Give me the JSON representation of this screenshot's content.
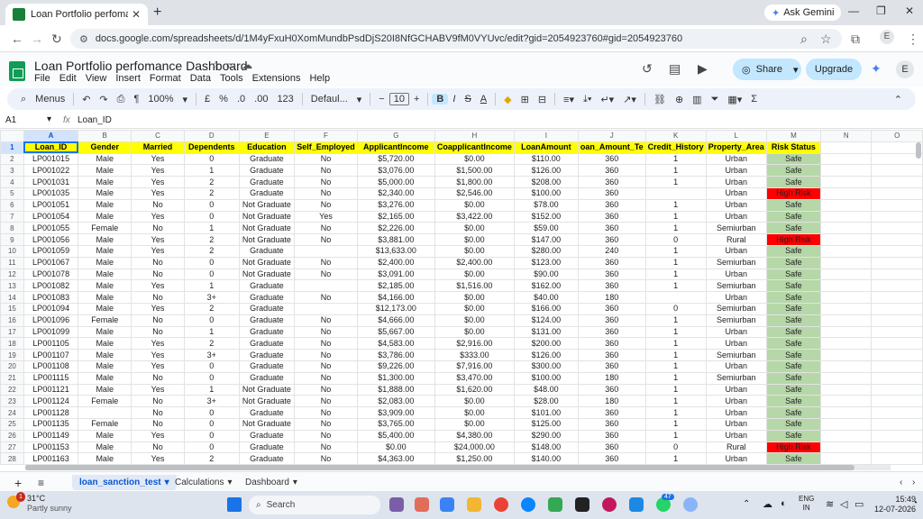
{
  "browser": {
    "tab_title": "Loan Portfolio perfomance Dash",
    "ask_gemini": "Ask Gemini",
    "url": "docs.google.com/spreadsheets/d/1M4yFxuH0XomMundbPsdDjS20I8NfGCHABV9fM0VYUvc/edit?gid=2054923760#gid=2054923760",
    "profile_initial": "E"
  },
  "sheets": {
    "title": "Loan Portfolio perfomance Dashboard",
    "menu": [
      "File",
      "Edit",
      "View",
      "Insert",
      "Format",
      "Data",
      "Tools",
      "Extensions",
      "Help"
    ],
    "share_label": "Share",
    "upgrade_label": "Upgrade",
    "profile_initial": "E"
  },
  "toolbar": {
    "menus": "Menus",
    "zoom": "100%",
    "currency": "£",
    "percent": "%",
    "dec_decrease": ".0",
    "dec_increase": ".00",
    "number_format": "123",
    "font": "Defaul...",
    "font_size": "10",
    "bold": "B",
    "italic": "I",
    "strike": "S",
    "text_color": "A",
    "sum": "Σ"
  },
  "formula_bar": {
    "name_box": "A1",
    "fx": "fx",
    "formula": "Loan_ID"
  },
  "columns": [
    "A",
    "B",
    "C",
    "D",
    "E",
    "F",
    "G",
    "H",
    "I",
    "J",
    "K",
    "L",
    "M",
    "N",
    "O"
  ],
  "headers": [
    "Loan_ID",
    "Gender",
    "Married",
    "Dependents",
    "Education",
    "Self_Employed",
    "ApplicantIncome",
    "CoapplicantIncome",
    "LoanAmount",
    "oan_Amount_Te",
    "Credit_History",
    "Property_Area",
    "Risk Status",
    "",
    ""
  ],
  "rows": [
    [
      "LP001015",
      "Male",
      "Yes",
      "0",
      "Graduate",
      "No",
      "$5,720.00",
      "$0.00",
      "$110.00",
      "360",
      "1",
      "Urban",
      "Safe"
    ],
    [
      "LP001022",
      "Male",
      "Yes",
      "1",
      "Graduate",
      "No",
      "$3,076.00",
      "$1,500.00",
      "$126.00",
      "360",
      "1",
      "Urban",
      "Safe"
    ],
    [
      "LP001031",
      "Male",
      "Yes",
      "2",
      "Graduate",
      "No",
      "$5,000.00",
      "$1,800.00",
      "$208.00",
      "360",
      "1",
      "Urban",
      "Safe"
    ],
    [
      "LP001035",
      "Male",
      "Yes",
      "2",
      "Graduate",
      "No",
      "$2,340.00",
      "$2,546.00",
      "$100.00",
      "360",
      "",
      "Urban",
      "High Risk"
    ],
    [
      "LP001051",
      "Male",
      "No",
      "0",
      "Not Graduate",
      "No",
      "$3,276.00",
      "$0.00",
      "$78.00",
      "360",
      "1",
      "Urban",
      "Safe"
    ],
    [
      "LP001054",
      "Male",
      "Yes",
      "0",
      "Not Graduate",
      "Yes",
      "$2,165.00",
      "$3,422.00",
      "$152.00",
      "360",
      "1",
      "Urban",
      "Safe"
    ],
    [
      "LP001055",
      "Female",
      "No",
      "1",
      "Not Graduate",
      "No",
      "$2,226.00",
      "$0.00",
      "$59.00",
      "360",
      "1",
      "Semiurban",
      "Safe"
    ],
    [
      "LP001056",
      "Male",
      "Yes",
      "2",
      "Not Graduate",
      "No",
      "$3,881.00",
      "$0.00",
      "$147.00",
      "360",
      "0",
      "Rural",
      "High Risk"
    ],
    [
      "LP001059",
      "Male",
      "Yes",
      "2",
      "Graduate",
      "",
      "$13,633.00",
      "$0.00",
      "$280.00",
      "240",
      "1",
      "Urban",
      "Safe"
    ],
    [
      "LP001067",
      "Male",
      "No",
      "0",
      "Not Graduate",
      "No",
      "$2,400.00",
      "$2,400.00",
      "$123.00",
      "360",
      "1",
      "Semiurban",
      "Safe"
    ],
    [
      "LP001078",
      "Male",
      "No",
      "0",
      "Not Graduate",
      "No",
      "$3,091.00",
      "$0.00",
      "$90.00",
      "360",
      "1",
      "Urban",
      "Safe"
    ],
    [
      "LP001082",
      "Male",
      "Yes",
      "1",
      "Graduate",
      "",
      "$2,185.00",
      "$1,516.00",
      "$162.00",
      "360",
      "1",
      "Semiurban",
      "Safe"
    ],
    [
      "LP001083",
      "Male",
      "No",
      "3+",
      "Graduate",
      "No",
      "$4,166.00",
      "$0.00",
      "$40.00",
      "180",
      "",
      "Urban",
      "Safe"
    ],
    [
      "LP001094",
      "Male",
      "Yes",
      "2",
      "Graduate",
      "",
      "$12,173.00",
      "$0.00",
      "$166.00",
      "360",
      "0",
      "Semiurban",
      "Safe"
    ],
    [
      "LP001096",
      "Female",
      "No",
      "0",
      "Graduate",
      "No",
      "$4,666.00",
      "$0.00",
      "$124.00",
      "360",
      "1",
      "Semiurban",
      "Safe"
    ],
    [
      "LP001099",
      "Male",
      "No",
      "1",
      "Graduate",
      "No",
      "$5,667.00",
      "$0.00",
      "$131.00",
      "360",
      "1",
      "Urban",
      "Safe"
    ],
    [
      "LP001105",
      "Male",
      "Yes",
      "2",
      "Graduate",
      "No",
      "$4,583.00",
      "$2,916.00",
      "$200.00",
      "360",
      "1",
      "Urban",
      "Safe"
    ],
    [
      "LP001107",
      "Male",
      "Yes",
      "3+",
      "Graduate",
      "No",
      "$3,786.00",
      "$333.00",
      "$126.00",
      "360",
      "1",
      "Semiurban",
      "Safe"
    ],
    [
      "LP001108",
      "Male",
      "Yes",
      "0",
      "Graduate",
      "No",
      "$9,226.00",
      "$7,916.00",
      "$300.00",
      "360",
      "1",
      "Urban",
      "Safe"
    ],
    [
      "LP001115",
      "Male",
      "No",
      "0",
      "Graduate",
      "No",
      "$1,300.00",
      "$3,470.00",
      "$100.00",
      "180",
      "1",
      "Semiurban",
      "Safe"
    ],
    [
      "LP001121",
      "Male",
      "Yes",
      "1",
      "Not Graduate",
      "No",
      "$1,888.00",
      "$1,620.00",
      "$48.00",
      "360",
      "1",
      "Urban",
      "Safe"
    ],
    [
      "LP001124",
      "Female",
      "No",
      "3+",
      "Not Graduate",
      "No",
      "$2,083.00",
      "$0.00",
      "$28.00",
      "180",
      "1",
      "Urban",
      "Safe"
    ],
    [
      "LP001128",
      "",
      "No",
      "0",
      "Graduate",
      "No",
      "$3,909.00",
      "$0.00",
      "$101.00",
      "360",
      "1",
      "Urban",
      "Safe"
    ],
    [
      "LP001135",
      "Female",
      "No",
      "0",
      "Not Graduate",
      "No",
      "$3,765.00",
      "$0.00",
      "$125.00",
      "360",
      "1",
      "Urban",
      "Safe"
    ],
    [
      "LP001149",
      "Male",
      "Yes",
      "0",
      "Graduate",
      "No",
      "$5,400.00",
      "$4,380.00",
      "$290.00",
      "360",
      "1",
      "Urban",
      "Safe"
    ],
    [
      "LP001153",
      "Male",
      "No",
      "0",
      "Graduate",
      "No",
      "$0.00",
      "$24,000.00",
      "$148.00",
      "360",
      "0",
      "Rural",
      "High Risk"
    ],
    [
      "LP001163",
      "Male",
      "Yes",
      "2",
      "Graduate",
      "No",
      "$4,363.00",
      "$1,250.00",
      "$140.00",
      "360",
      "1",
      "Urban",
      "Safe"
    ]
  ],
  "sheet_tabs": [
    "loan_sanction_test",
    "Calculations",
    "Dashboard"
  ],
  "taskbar": {
    "temperature": "31°C",
    "weather": "Partly sunny",
    "weather_badge": "1",
    "search_placeholder": "Search",
    "mail_badge": "47",
    "lang_line1": "ENG",
    "lang_line2": "IN",
    "time": "15:49",
    "date": "12-07-2026"
  },
  "colors": {
    "header_fill": "#ffff00",
    "safe_fill": "#b6d7a8",
    "high_risk_fill": "#ff0000"
  }
}
